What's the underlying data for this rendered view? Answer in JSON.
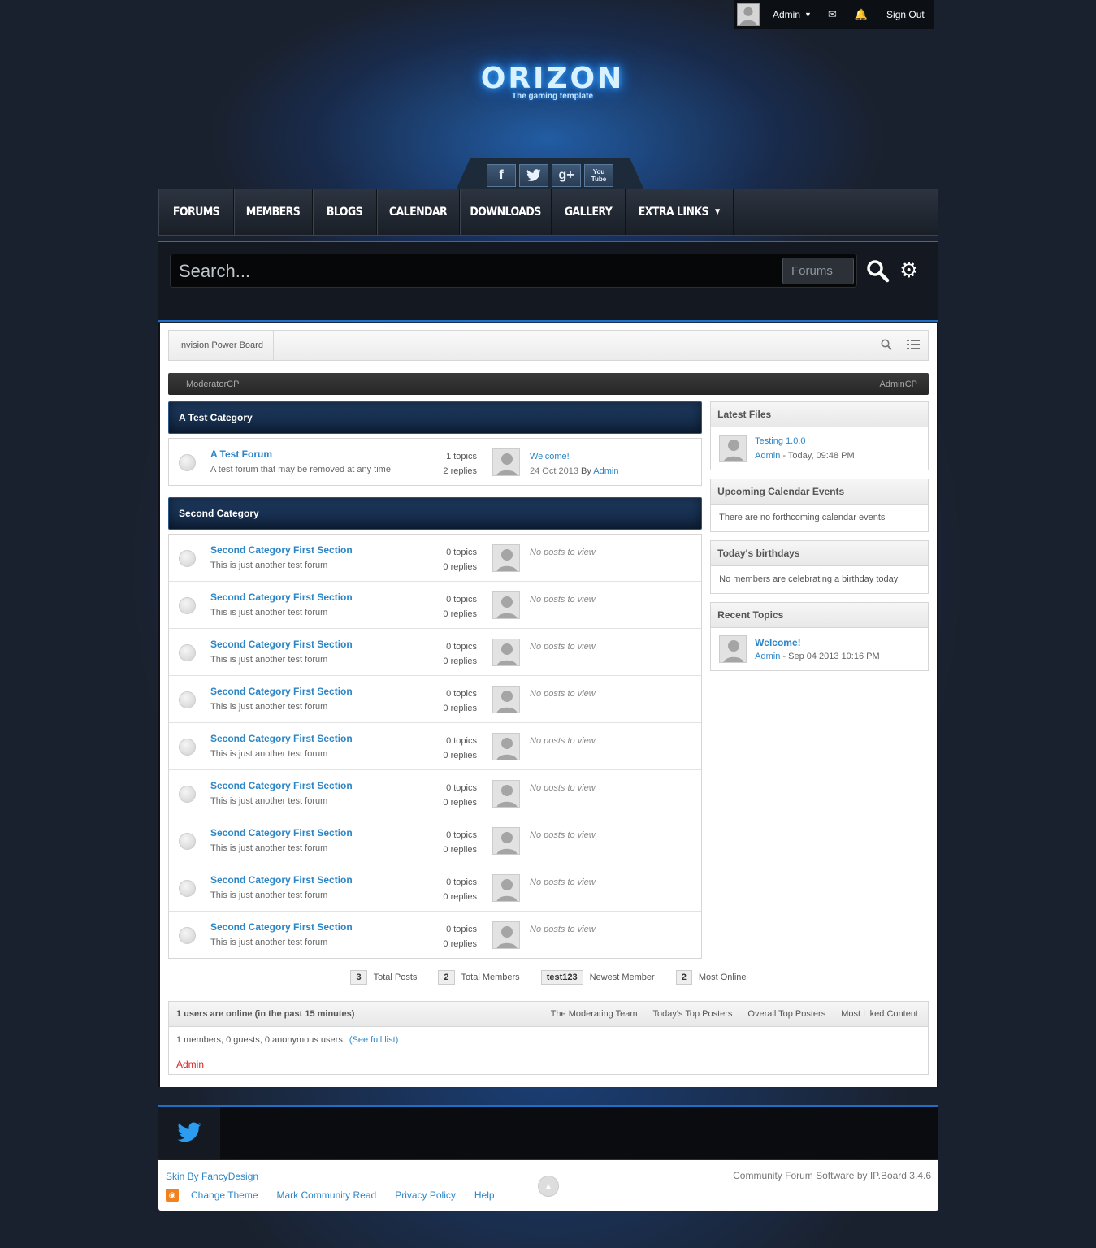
{
  "userbar": {
    "username": "Admin",
    "signout": "Sign Out"
  },
  "logo": {
    "word": "ORIZON",
    "tagline": "The gaming template"
  },
  "social": [
    "f",
    "t",
    "g+",
    "You Tube"
  ],
  "nav": [
    {
      "label": "FORUMS"
    },
    {
      "label": "MEMBERS"
    },
    {
      "label": "BLOGS"
    },
    {
      "label": "CALENDAR"
    },
    {
      "label": "DOWNLOADS"
    },
    {
      "label": "GALLERY"
    },
    {
      "label": "EXTRA LINKS"
    }
  ],
  "search": {
    "placeholder": "Search...",
    "scope": "Forums"
  },
  "breadcrumb": {
    "root": "Invision Power Board"
  },
  "modbar": {
    "left": "ModeratorCP",
    "right": "AdminCP"
  },
  "categories": [
    {
      "title": "A Test Category",
      "forums": [
        {
          "name": "A Test Forum",
          "desc": "A test forum that may be removed at any time",
          "topics": "1 topics",
          "replies": "2 replies",
          "last_title": "Welcome!",
          "last_date": "24 Oct 2013",
          "by": "By",
          "last_author": "Admin"
        }
      ]
    },
    {
      "title": "Second Category",
      "forums": [
        {
          "name": "Second Category First Section",
          "desc": "This is just another test forum",
          "topics": "0 topics",
          "replies": "0 replies",
          "none": "No posts to view"
        },
        {
          "name": "Second Category First Section",
          "desc": "This is just another test forum",
          "topics": "0 topics",
          "replies": "0 replies",
          "none": "No posts to view"
        },
        {
          "name": "Second Category First Section",
          "desc": "This is just another test forum",
          "topics": "0 topics",
          "replies": "0 replies",
          "none": "No posts to view"
        },
        {
          "name": "Second Category First Section",
          "desc": "This is just another test forum",
          "topics": "0 topics",
          "replies": "0 replies",
          "none": "No posts to view"
        },
        {
          "name": "Second Category First Section",
          "desc": "This is just another test forum",
          "topics": "0 topics",
          "replies": "0 replies",
          "none": "No posts to view"
        },
        {
          "name": "Second Category First Section",
          "desc": "This is just another test forum",
          "topics": "0 topics",
          "replies": "0 replies",
          "none": "No posts to view"
        },
        {
          "name": "Second Category First Section",
          "desc": "This is just another test forum",
          "topics": "0 topics",
          "replies": "0 replies",
          "none": "No posts to view"
        },
        {
          "name": "Second Category First Section",
          "desc": "This is just another test forum",
          "topics": "0 topics",
          "replies": "0 replies",
          "none": "No posts to view"
        },
        {
          "name": "Second Category First Section",
          "desc": "This is just another test forum",
          "topics": "0 topics",
          "replies": "0 replies",
          "none": "No posts to view"
        }
      ]
    }
  ],
  "sidebar": {
    "latest_files": {
      "title": "Latest Files",
      "item_title": "Testing 1.0.0",
      "item_author": "Admin",
      "item_meta": " - Today, 09:48 PM"
    },
    "calendar": {
      "title": "Upcoming Calendar Events",
      "text": "There are no forthcoming calendar events"
    },
    "birthdays": {
      "title": "Today's birthdays",
      "text": "No members are celebrating a birthday today"
    },
    "recent_topics": {
      "title": "Recent Topics",
      "item_title": "Welcome!",
      "item_author": "Admin",
      "item_meta": " - Sep 04 2013 10:16 PM"
    }
  },
  "stats": [
    {
      "value": "3",
      "label": "Total Posts"
    },
    {
      "value": "2",
      "label": "Total Members"
    },
    {
      "value": "test123",
      "label": "Newest Member"
    },
    {
      "value": "2",
      "label": "Most Online"
    }
  ],
  "online": {
    "title": "1 users are online (in the past 15 minutes)",
    "links": [
      "The Moderating Team",
      "Today's Top Posters",
      "Overall Top Posters",
      "Most Liked Content"
    ],
    "summary": "1 members, 0 guests, 0 anonymous users",
    "see_full": "(See full list)",
    "user": "Admin"
  },
  "footer": {
    "skin": "Skin By FancyDesign",
    "links": [
      "Change Theme",
      "Mark Community Read",
      "Privacy Policy",
      "Help"
    ],
    "powered": "Community Forum Software by IP.Board 3.4.6"
  },
  "colors": {
    "accent": "#2c86c6",
    "category_header": "#1f3c62",
    "admin_name": "#dd2222"
  }
}
